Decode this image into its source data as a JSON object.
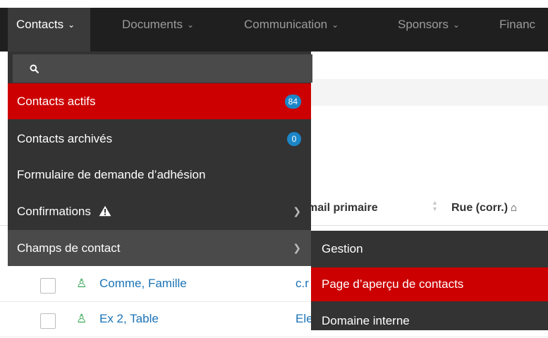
{
  "nav": {
    "items": [
      {
        "label": "Contacts",
        "active": true
      },
      {
        "label": "Documents"
      },
      {
        "label": "Communication"
      },
      {
        "label": "Sponsors"
      },
      {
        "label": "Financ"
      }
    ]
  },
  "table": {
    "headers": {
      "email": "mail primaire",
      "street": "Rue (corr.)"
    },
    "rows": [
      {
        "name": "Comme, Famille",
        "email": "c.r"
      },
      {
        "name": "Ex 2, Table",
        "email": "Ele"
      }
    ]
  },
  "dropdown": {
    "items": [
      {
        "label": "Contacts actifs",
        "badge": "84"
      },
      {
        "label": "Contacts archivés",
        "badge": "0"
      },
      {
        "label": "Formulaire de demande d’adhésion"
      },
      {
        "label": "Confirmations"
      },
      {
        "label": "Champs de contact"
      }
    ]
  },
  "submenu": {
    "items": [
      {
        "label": "Gestion"
      },
      {
        "label": "Page d’aperçu de contacts"
      },
      {
        "label": "Domaine interne"
      }
    ]
  },
  "colors": {
    "navbar": "#1f1f1f",
    "menu": "#333333",
    "highlight": "#cc0000",
    "badge": "#1b86c7",
    "link": "#1a73b6",
    "person": "#2ea44f"
  },
  "icons": [
    "chevron-down-icon",
    "search-icon",
    "warning-icon",
    "chevron-right-icon",
    "sort-icon",
    "home-icon",
    "person-icon"
  ]
}
